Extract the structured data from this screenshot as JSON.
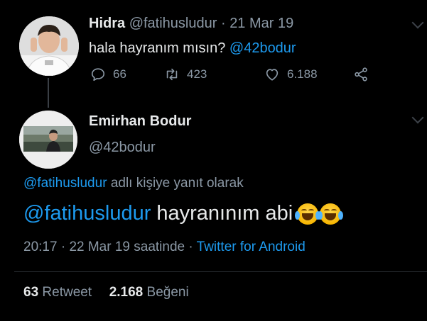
{
  "parent_tweet": {
    "name": "Hidra",
    "handle": "@fatihusludur",
    "separator": "·",
    "date": "21 Mar 19",
    "text": "hala hayranım mısın?",
    "mention": "@42bodur",
    "actions": {
      "replies": "66",
      "retweets": "423",
      "likes": "6.188"
    }
  },
  "main_tweet": {
    "name": "Emirhan Bodur",
    "handle": "@42bodur",
    "reply_to_mention": "@fatihusludur",
    "reply_to_suffix": "adlı kişiye yanıt olarak",
    "mention": "@fatihusludur",
    "text": "hayranınım abi",
    "emoji": [
      "face-with-tears-of-joy",
      "face-with-tears-of-joy"
    ],
    "time": "20:17",
    "separator": "·",
    "date_text": "22 Mar 19 saatinde",
    "separator_2": "·",
    "source": "Twitter for Android",
    "stats": {
      "retweets_count": "63",
      "retweets_label": "Retweet",
      "likes_count": "2.168",
      "likes_label": "Beğeni"
    }
  },
  "colors": {
    "background": "#000000",
    "accent": "#1d9bf0",
    "secondary_text": "#8b98a5",
    "primary_text": "#e7e9ea"
  }
}
